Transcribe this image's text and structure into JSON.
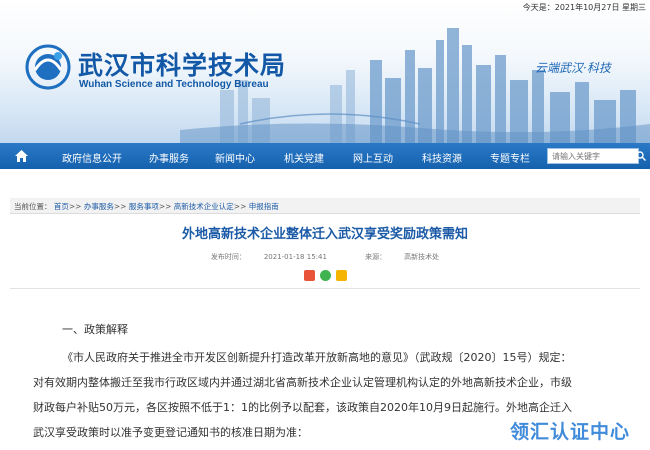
{
  "topbar": {
    "date_text": "今天是：2021年10月27日 星期三"
  },
  "header": {
    "site_name": "武汉市科学技术局",
    "site_name_en": "Wuhan Science and Technology Bureau",
    "slogan": "云端武汉·科技"
  },
  "nav": {
    "items": [
      "政府信息公开",
      "办事服务",
      "新闻中心",
      "机关党建",
      "网上互动",
      "科技资源",
      "专题专栏"
    ],
    "search_placeholder": "请输入关键字",
    "colors": {
      "bar": "#1561ae",
      "text": "#ffffff"
    }
  },
  "breadcrumb": {
    "label": "当前位置：",
    "items": [
      "首页",
      "办事服务",
      "服务事项",
      "高新技术企业认定",
      "申报指南"
    ],
    "separator": ">>"
  },
  "article": {
    "title": "外地高新技术企业整体迁入武汉享受奖励政策需知",
    "publish_label": "发布时间：",
    "publish_time": "2021-01-18 15:41",
    "source_label": "来源：",
    "source": "高新技术处",
    "section_heading": "一、政策解释",
    "paragraph_lines": [
      "《市人民政府关于推进全市开发区创新提升打造改革开放新高地的意见》（武政规〔2020〕15号）规定：",
      "对有效期内整体搬迁至我市行政区域内并通过湖北省高新技术企业认定管理机构认定的外地高新技术企业，市级",
      "财政每户补贴50万元，各区按照不低于1：1的比例予以配套，该政策自2020年10月9日起施行。外地高企迁入",
      "武汉享受政策时以准予变更登记通知书的核准日期为准："
    ]
  },
  "watermark": {
    "text": "领汇认证中心"
  },
  "icons": [
    "home-icon",
    "search-icon",
    "weibo-share-icon",
    "wechat-share-icon",
    "qzone-share-icon"
  ]
}
